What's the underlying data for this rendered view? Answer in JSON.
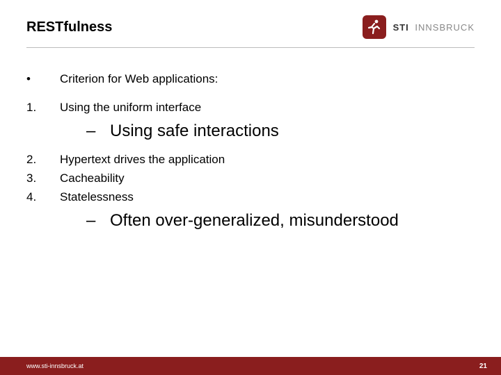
{
  "header": {
    "title": "RESTfulness",
    "logo_bold": "STI",
    "logo_light": "INNSBRUCK"
  },
  "content": {
    "lead": {
      "marker": "•",
      "text": "Criterion for Web applications:"
    },
    "items": [
      {
        "marker": "1.",
        "text": "Using the uniform interface"
      }
    ],
    "sub1": {
      "marker": "–",
      "text": "Using safe interactions"
    },
    "items2": [
      {
        "marker": "2.",
        "text": "Hypertext drives the application"
      },
      {
        "marker": "3.",
        "text": "Cacheability"
      },
      {
        "marker": "4.",
        "text": "Statelessness"
      }
    ],
    "sub2": {
      "marker": "–",
      "text": "Often over-generalized, misunderstood"
    }
  },
  "footer": {
    "url": "www.sti-innsbruck.at",
    "page": "21"
  }
}
